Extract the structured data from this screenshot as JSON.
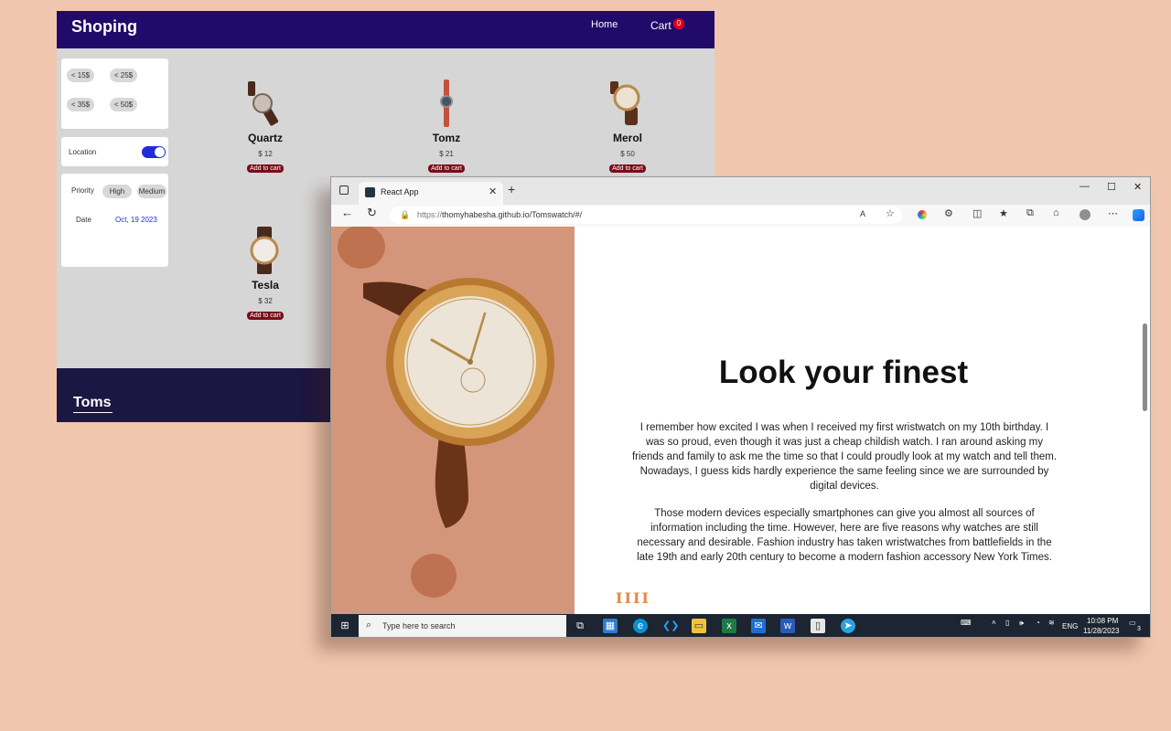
{
  "shop": {
    "brand": "Shoping",
    "nav": {
      "home": "Home",
      "cart": "Cart",
      "cart_count": "0"
    },
    "price_filters": [
      "< 15$",
      "< 25$",
      "< 35$",
      "< 50$"
    ],
    "location_label": "Location",
    "priority_label": "Priority",
    "priority_options": [
      "High",
      "Medium"
    ],
    "date_label": "Date",
    "date_value": "Oct, 19 2023",
    "products": [
      {
        "name": "Quartz",
        "price": "$ 12",
        "button": "Add to cart"
      },
      {
        "name": "Tomz",
        "price": "$ 21",
        "button": "Add to cart"
      },
      {
        "name": "Merol",
        "price": "$ 50",
        "button": "Add to cart"
      },
      {
        "name": "Tesla",
        "price": "$ 32",
        "button": "Add to cart"
      }
    ],
    "footer_brand": "Toms"
  },
  "browser": {
    "tab_title": "React App",
    "url_prefix": "https://",
    "url": "thomyhabesha.github.io/Tomswatch/#/",
    "page": {
      "heading": "Look your finest",
      "paragraph1": "I remember how excited I was when I received my first wristwatch on my 10th birthday. I was so proud, even though it was just a cheap childish watch. I ran around asking my friends and family to ask me the time so that I could proudly look at my watch and tell them. Nowadays, I guess kids hardly experience the same feeling since we are surrounded by digital devices.",
      "paragraph2": "Those modern devices especially smartphones can give you almost all sources of information including the time. However, here are five reasons why watches are still necessary and desirable. Fashion industry has taken wristwatches from battlefields in the late 19th and early 20th century to become a modern fashion accessory New York Times."
    }
  },
  "taskbar": {
    "search_placeholder": "Type here to search",
    "language": "ENG",
    "time": "10:08 PM",
    "date": "11/28/2023",
    "notification_count": "3"
  },
  "colors": {
    "shop_nav": "#220a6a",
    "shop_footer": "#1c1642",
    "add_to_cart": "#7a0c19",
    "hero_bg": "#d3967a",
    "page_bg": "#f1c6ae"
  }
}
